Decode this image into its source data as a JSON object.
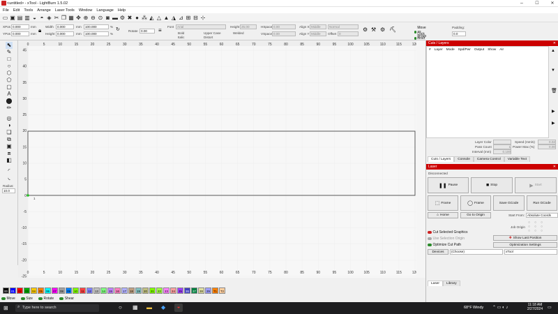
{
  "window": {
    "title": "<untitled> - xTool - LightBurn 1.5.02",
    "min": "–",
    "max": "☐",
    "close": "✕"
  },
  "menu": [
    "File",
    "Edit",
    "Tools",
    "Arrange",
    "Laser Tools",
    "Window",
    "Language",
    "Help"
  ],
  "toolbar_icons": [
    "open-icon",
    "save-icon",
    "save-as-icon",
    "import-icon",
    "undo-icon",
    "redo-icon",
    "select-all-icon",
    "cut-icon",
    "copy-icon",
    "paste-icon",
    "move-icon",
    "zoom-in-icon",
    "zoom-out-icon",
    "zoom-frame-icon",
    "camera-icon",
    "monitor-icon",
    "settings-icon",
    "tools-icon",
    "user-icon",
    "group-icon",
    "weld-icon",
    "pin-icon",
    "align-icon",
    "distribute-icon",
    "mirror-icon",
    "grid-icon",
    "array-icon",
    "snap-icon"
  ],
  "props": {
    "xpos_label": "XPos",
    "xpos": "0.000",
    "ypos_label": "YPos",
    "ypos": "0.000",
    "width_label": "Width",
    "width": "0.000",
    "height_label": "Height",
    "height": "0.000",
    "unit": "mm",
    "pct1": "100.000",
    "pct2": "100.000",
    "pct": "%",
    "rotate_label": "Rotate",
    "rotate": "0.00",
    "font_label": "Font",
    "font": "Arial",
    "bold": "Bold",
    "italic": "Italic",
    "upper": "Upper Case",
    "welded": "Welded",
    "distort": "Distort",
    "height2_label": "Height",
    "height2": "25.00",
    "hspace_label": "HSpace",
    "hspace": "0.00",
    "vspace_label": "VSpace",
    "vspace": "0.00",
    "alignx_label": "Align X",
    "alignx": "Middle",
    "aligny_label": "Align Y",
    "aligny": "Middle",
    "normal": "Normal",
    "offset_label": "Offset",
    "offset": "0",
    "move_group": "Move as group",
    "lock_inner": "Lock inner objects",
    "padding_label": "Padding:",
    "padding": "0.0"
  },
  "ruler_x": [
    "0",
    "5",
    "10",
    "15",
    "20",
    "25",
    "30",
    "35",
    "40",
    "45",
    "50",
    "55",
    "60",
    "65",
    "70",
    "75",
    "80",
    "85",
    "90",
    "95",
    "100",
    "105",
    "110",
    "115",
    "120"
  ],
  "ruler_y": [
    "45",
    "40",
    "35",
    "30",
    "25",
    "20",
    "15",
    "10",
    "5",
    "0",
    "-5",
    "-10",
    "-15",
    "-20",
    "-25"
  ],
  "radius_label": "Radius:",
  "radius": "10.0",
  "palette": [
    "00",
    "01",
    "02",
    "03",
    "04",
    "05",
    "06",
    "07",
    "08",
    "09",
    "10",
    "11",
    "12",
    "13",
    "14",
    "15",
    "16",
    "17",
    "18",
    "19",
    "20",
    "21",
    "22",
    "23",
    "24",
    "25",
    "26",
    "27",
    "28",
    "29",
    "T1",
    "T2"
  ],
  "palette_colors": [
    "#000000",
    "#0000ff",
    "#ff0000",
    "#00aa00",
    "#ffcc00",
    "#ff8000",
    "#00ffff",
    "#ff00ff",
    "#a0a0a0",
    "#0080ff",
    "#80ff00",
    "#ff4040",
    "#8080ff",
    "#c0c0c0",
    "#80ff80",
    "#c080ff",
    "#ff80c0",
    "#b0b0ff",
    "#c0a080",
    "#80c0c0",
    "#c0c080",
    "#80ff00",
    "#a0ff40",
    "#ff80ff",
    "#ffa0a0",
    "#a040ff",
    "#4040c0",
    "#008040",
    "#e0e0a0",
    "#a0a0ff",
    "#ff8000",
    "#ffd0a0"
  ],
  "status": {
    "move": "Move",
    "size": "Size",
    "rotate": "Rotate",
    "shear": "Shear"
  },
  "cuts": {
    "title": "Cuts / Layers",
    "cols": [
      "#",
      "Layer",
      "Mode",
      "Spd/Pwr",
      "Output",
      "Show",
      "Air"
    ],
    "layer_color": "Layer Color",
    "pass_count": "Pass Count",
    "pass_val": "1",
    "interval": "Interval (mm)",
    "interval_val": "0.100",
    "speed": "Speed (mm/s)",
    "speed_val": "0.02",
    "power": "Power Max (%)",
    "power_val": "0.00",
    "tabs": [
      "Cuts / Layers",
      "Console",
      "Camera Control",
      "Variable Text"
    ]
  },
  "laser": {
    "title": "Laser",
    "state": "Disconnected",
    "pause": "Pause",
    "stop": "Stop",
    "start": "Start",
    "frame1": "Frame",
    "frame2": "Frame",
    "save_gcode": "Save GCode",
    "run_gcode": "Run GCode",
    "home": "Home",
    "go_origin": "Go to Origin",
    "start_from_label": "Start From:",
    "start_from": "Absolute Coords",
    "job_origin": "Job Origin",
    "cut_selected": "Cut Selected Graphics",
    "use_sel_origin": "Use Selection Origin",
    "optimize": "Optimize Cut Path",
    "show_last": "Show Last Position",
    "opt_settings": "Optimization Settings",
    "devices": "Devices",
    "choose": "(Choose)",
    "device": "xTool",
    "tabs": [
      "Laser",
      "Library"
    ]
  },
  "taskbar": {
    "search": "Type here to search",
    "weather": "68°F",
    "weather2": "Windy",
    "time": "11:18 AM",
    "date": "2/27/2024"
  }
}
